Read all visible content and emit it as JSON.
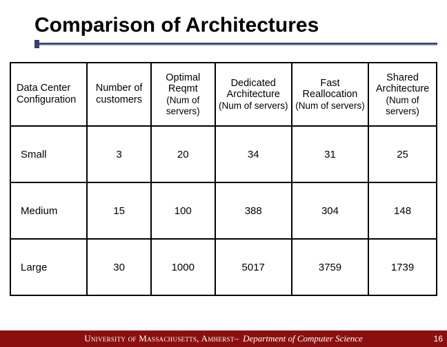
{
  "title": "Comparison of Architectures",
  "chart_data": {
    "type": "table",
    "columns": [
      "Data Center Configuration",
      "Number of customers",
      "Optimal Reqmt (Num of servers)",
      "Dedicated Architecture (Num of servers)",
      "Fast Reallocation (Num of servers)",
      "Shared Architecture (Num of servers)"
    ],
    "rows": [
      {
        "config": "Small",
        "customers": 3,
        "optimal": 20,
        "dedicated": 34,
        "fast": 31,
        "shared": 25
      },
      {
        "config": "Medium",
        "customers": 15,
        "optimal": 100,
        "dedicated": 388,
        "fast": 304,
        "shared": 148
      },
      {
        "config": "Large",
        "customers": 30,
        "optimal": 1000,
        "dedicated": 5017,
        "fast": 3759,
        "shared": 1739
      }
    ]
  },
  "headers": {
    "c0": "Data Center Configuration",
    "c1": "Number of customers",
    "c2_l1": "Optimal Reqmt",
    "c2_l2": "(Num of servers)",
    "c3_l1": "Dedicated Architecture",
    "c3_l2": "(Num of servers)",
    "c4_l1": "Fast Reallocation",
    "c4_l2": "(Num of servers)",
    "c5_l1": "Shared Architecture",
    "c5_l2": "(Num of servers)"
  },
  "footer": {
    "univ": "University of Massachusetts, Amherst",
    "sep": " – ",
    "dept": "Department of Computer Science",
    "page": "16"
  }
}
